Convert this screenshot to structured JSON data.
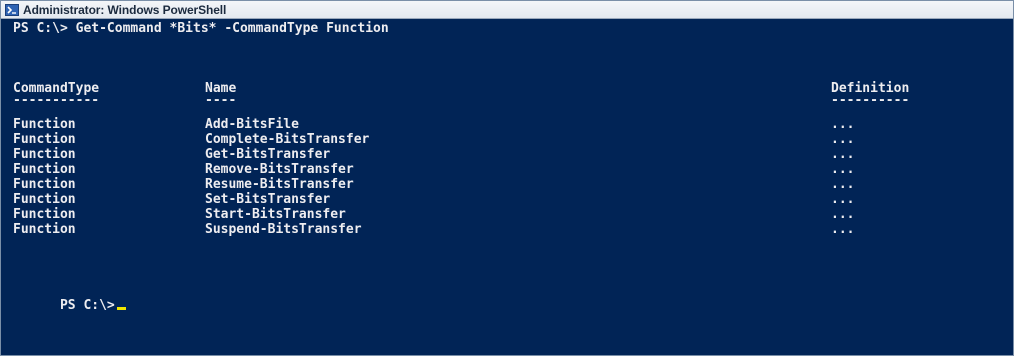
{
  "window": {
    "title": "Administrator: Windows PowerShell"
  },
  "icons": {
    "app": "powershell-icon"
  },
  "console": {
    "command_line": "PS C:\\> Get-Command *Bits* -CommandType Function",
    "headers": {
      "command_type": "CommandType",
      "name": "Name",
      "definition": "Definition"
    },
    "underlines": {
      "command_type": "-----------",
      "name": "----",
      "definition": "----------"
    },
    "rows": [
      {
        "command_type": "Function",
        "name": "Add-BitsFile",
        "definition": "..."
      },
      {
        "command_type": "Function",
        "name": "Complete-BitsTransfer",
        "definition": "..."
      },
      {
        "command_type": "Function",
        "name": "Get-BitsTransfer",
        "definition": "..."
      },
      {
        "command_type": "Function",
        "name": "Remove-BitsTransfer",
        "definition": "..."
      },
      {
        "command_type": "Function",
        "name": "Resume-BitsTransfer",
        "definition": "..."
      },
      {
        "command_type": "Function",
        "name": "Set-BitsTransfer",
        "definition": "..."
      },
      {
        "command_type": "Function",
        "name": "Start-BitsTransfer",
        "definition": "..."
      },
      {
        "command_type": "Function",
        "name": "Suspend-BitsTransfer",
        "definition": "..."
      }
    ],
    "prompt": "PS C:\\>"
  },
  "colors": {
    "console_background": "#012456",
    "console_text": "#eeedf0",
    "cursor": "#f0e600"
  }
}
